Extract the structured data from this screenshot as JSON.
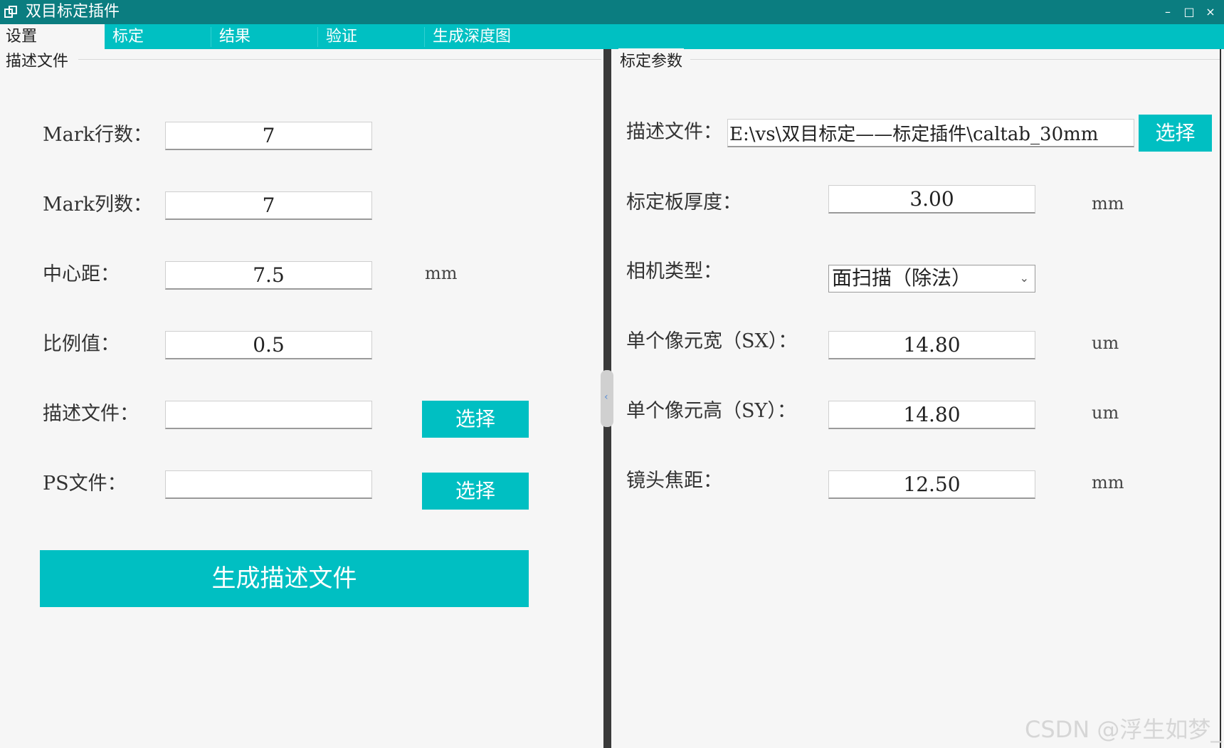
{
  "window": {
    "title": "双目标定插件",
    "minimize": "–",
    "maximize": "□",
    "close": "×"
  },
  "tabs": [
    {
      "label": "设置",
      "active": true
    },
    {
      "label": "标定"
    },
    {
      "label": "结果"
    },
    {
      "label": "验证"
    },
    {
      "label": "生成深度图"
    }
  ],
  "left": {
    "group_title": "描述文件",
    "rows": [
      {
        "label": "Mark行数：",
        "value": "7",
        "unit": ""
      },
      {
        "label": "Mark列数：",
        "value": "7",
        "unit": ""
      },
      {
        "label": "中心距：",
        "value": "7.5",
        "unit": "mm"
      },
      {
        "label": "比例值：",
        "value": "0.5",
        "unit": ""
      },
      {
        "label": "描述文件：",
        "value": "",
        "button": "选择"
      },
      {
        "label": "PS文件：",
        "value": "",
        "button": "选择"
      }
    ],
    "generate_button": "生成描述文件"
  },
  "right": {
    "group_title": "标定参数",
    "desc_file_label": "描述文件：",
    "desc_file_value": "E:\\vs\\双目标定——标定插件\\caltab_30mm",
    "desc_file_button": "选择",
    "thickness_label": "标定板厚度：",
    "thickness_value": "3.00",
    "thickness_unit": "mm",
    "camera_type_label": "相机类型：",
    "camera_type_value": "面扫描（除法）",
    "sx_label": "单个像元宽（SX）：",
    "sx_value": "14.80",
    "sx_unit": "um",
    "sy_label": "单个像元高（SY）：",
    "sy_value": "14.80",
    "sy_unit": "um",
    "focal_label": "镜头焦距：",
    "focal_value": "12.50",
    "focal_unit": "mm"
  },
  "watermark": "CSDN @浮生如梦_",
  "colors": {
    "titlebar": "#0b7d80",
    "accent": "#00c0c2",
    "background": "#f6f6f6"
  }
}
